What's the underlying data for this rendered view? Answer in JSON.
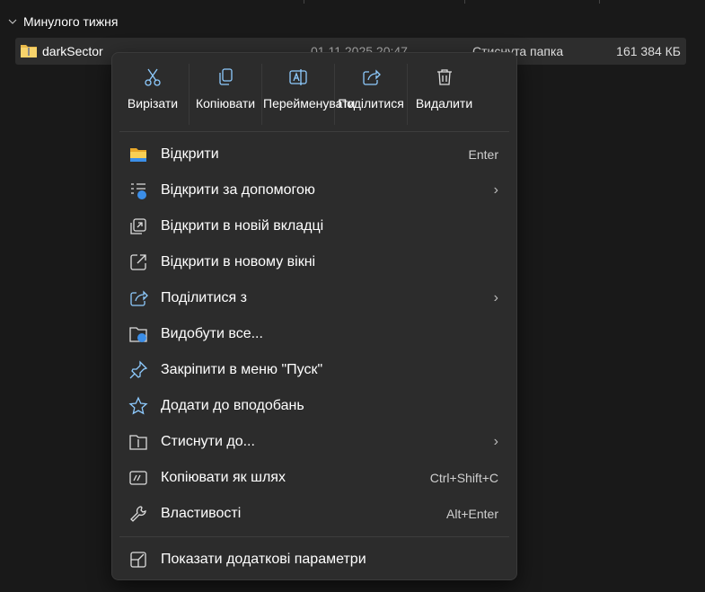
{
  "group": {
    "label": "Минулого тижня"
  },
  "file": {
    "name": "darkSector",
    "date": "01.11.2025 20:47",
    "type": "Стиснута папка",
    "size": "161 384 КБ"
  },
  "toolbar": [
    {
      "icon": "scissors-icon",
      "label": "Вирізати"
    },
    {
      "icon": "copy-icon",
      "label": "Копіювати"
    },
    {
      "icon": "rename-icon",
      "label": "Перейменувати"
    },
    {
      "icon": "share-icon",
      "label": "Поділитися"
    },
    {
      "icon": "trash-icon",
      "label": "Видалити"
    }
  ],
  "items": [
    {
      "icon": "folder-icon",
      "label": "Відкрити",
      "shortcut": "Enter"
    },
    {
      "icon": "open-with-icon",
      "label": "Відкрити за допомогою",
      "submenu": true
    },
    {
      "icon": "new-tab-icon",
      "label": "Відкрити в новій вкладці"
    },
    {
      "icon": "new-window-icon",
      "label": "Відкрити в новому вікні"
    },
    {
      "icon": "share-icon",
      "label": "Поділитися з",
      "submenu": true
    },
    {
      "icon": "extract-icon",
      "label": "Видобути все..."
    },
    {
      "icon": "pin-icon",
      "label": "Закріпити в меню \"Пуск\""
    },
    {
      "icon": "star-icon",
      "label": "Додати до вподобань"
    },
    {
      "icon": "compress-icon",
      "label": "Стиснути до...",
      "submenu": true
    },
    {
      "icon": "path-icon",
      "label": "Копіювати як шлях",
      "shortcut": "Ctrl+Shift+C"
    },
    {
      "icon": "wrench-icon",
      "label": "Властивості",
      "shortcut": "Alt+Enter"
    }
  ],
  "more": {
    "icon": "more-options-icon",
    "label": "Показати додаткові параметри"
  }
}
